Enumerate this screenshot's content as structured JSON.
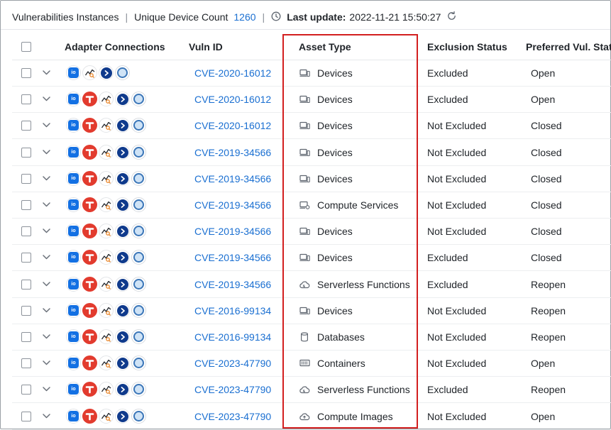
{
  "header": {
    "title": "Vulnerabilities Instances",
    "unique_label": "Unique Device Count",
    "unique_count": "1260",
    "last_update_label": "Last update:",
    "last_update_value": "2022-11-21 15:50:27",
    "clock_icon": "clock-icon",
    "refresh_icon": "refresh-icon"
  },
  "columns": {
    "adapter_connections": "Adapter Connections",
    "vuln_id": "Vuln ID",
    "asset_type": "Asset Type",
    "exclusion_status": "Exclusion Status",
    "preferred_status": "Preferred Vul. Status"
  },
  "colors": {
    "link": "#1a6fd1",
    "highlight": "#d31f1f",
    "adapter_io": "#1370e3",
    "adapter_t": "#e23b2e",
    "adapter_circle": "#0f3a8c"
  },
  "rows": [
    {
      "adapters": [
        "io-adapter",
        "trend-adapter",
        "circle-adapter",
        "seal-adapter"
      ],
      "vuln_id": "CVE-2020-16012",
      "asset_type": "Devices",
      "asset_icon": "device-icon",
      "exclusion": "Excluded",
      "status": "Open"
    },
    {
      "adapters": [
        "io-adapter",
        "t-adapter",
        "trend-adapter",
        "circle-adapter",
        "seal-adapter"
      ],
      "vuln_id": "CVE-2020-16012",
      "asset_type": "Devices",
      "asset_icon": "device-icon",
      "exclusion": "Excluded",
      "status": "Open"
    },
    {
      "adapters": [
        "io-adapter",
        "t-adapter",
        "trend-adapter",
        "circle-adapter",
        "seal-adapter"
      ],
      "vuln_id": "CVE-2020-16012",
      "asset_type": "Devices",
      "asset_icon": "device-icon",
      "exclusion": "Not Excluded",
      "status": "Closed"
    },
    {
      "adapters": [
        "io-adapter",
        "t-adapter",
        "trend-adapter",
        "circle-adapter",
        "seal-adapter"
      ],
      "vuln_id": "CVE-2019-34566",
      "asset_type": "Devices",
      "asset_icon": "device-icon",
      "exclusion": "Not Excluded",
      "status": "Closed"
    },
    {
      "adapters": [
        "io-adapter",
        "t-adapter",
        "trend-adapter",
        "circle-adapter",
        "seal-adapter"
      ],
      "vuln_id": "CVE-2019-34566",
      "asset_type": "Devices",
      "asset_icon": "device-icon",
      "exclusion": "Not Excluded",
      "status": "Closed"
    },
    {
      "adapters": [
        "io-adapter",
        "t-adapter",
        "trend-adapter",
        "circle-adapter",
        "seal-adapter"
      ],
      "vuln_id": "CVE-2019-34566",
      "asset_type": "Compute Services",
      "asset_icon": "compute-service-icon",
      "exclusion": "Not Excluded",
      "status": "Closed"
    },
    {
      "adapters": [
        "io-adapter",
        "t-adapter",
        "trend-adapter",
        "circle-adapter",
        "seal-adapter"
      ],
      "vuln_id": "CVE-2019-34566",
      "asset_type": "Devices",
      "asset_icon": "device-icon",
      "exclusion": "Not Excluded",
      "status": "Closed"
    },
    {
      "adapters": [
        "io-adapter",
        "t-adapter",
        "trend-adapter",
        "circle-adapter",
        "seal-adapter"
      ],
      "vuln_id": "CVE-2019-34566",
      "asset_type": "Devices",
      "asset_icon": "device-icon",
      "exclusion": "Excluded",
      "status": "Closed"
    },
    {
      "adapters": [
        "io-adapter",
        "t-adapter",
        "trend-adapter",
        "circle-adapter",
        "seal-adapter"
      ],
      "vuln_id": "CVE-2019-34566",
      "asset_type": "Serverless Functions",
      "asset_icon": "serverless-icon",
      "exclusion": "Excluded",
      "status": "Reopen"
    },
    {
      "adapters": [
        "io-adapter",
        "t-adapter",
        "trend-adapter",
        "circle-adapter",
        "seal-adapter"
      ],
      "vuln_id": "CVE-2016-99134",
      "asset_type": "Devices",
      "asset_icon": "device-icon",
      "exclusion": "Not Excluded",
      "status": "Reopen"
    },
    {
      "adapters": [
        "io-adapter",
        "t-adapter",
        "trend-adapter",
        "circle-adapter",
        "seal-adapter"
      ],
      "vuln_id": "CVE-2016-99134",
      "asset_type": "Databases",
      "asset_icon": "database-icon",
      "exclusion": "Not Excluded",
      "status": "Reopen"
    },
    {
      "adapters": [
        "io-adapter",
        "t-adapter",
        "trend-adapter",
        "circle-adapter",
        "seal-adapter"
      ],
      "vuln_id": "CVE-2023-47790",
      "asset_type": "Containers",
      "asset_icon": "container-icon",
      "exclusion": "Not Excluded",
      "status": "Open"
    },
    {
      "adapters": [
        "io-adapter",
        "t-adapter",
        "trend-adapter",
        "circle-adapter",
        "seal-adapter"
      ],
      "vuln_id": "CVE-2023-47790",
      "asset_type": "Serverless Functions",
      "asset_icon": "serverless-icon",
      "exclusion": "Excluded",
      "status": "Reopen"
    },
    {
      "adapters": [
        "io-adapter",
        "t-adapter",
        "trend-adapter",
        "circle-adapter",
        "seal-adapter"
      ],
      "vuln_id": "CVE-2023-47790",
      "asset_type": "Compute Images",
      "asset_icon": "compute-image-icon",
      "exclusion": "Not Excluded",
      "status": "Open"
    }
  ]
}
